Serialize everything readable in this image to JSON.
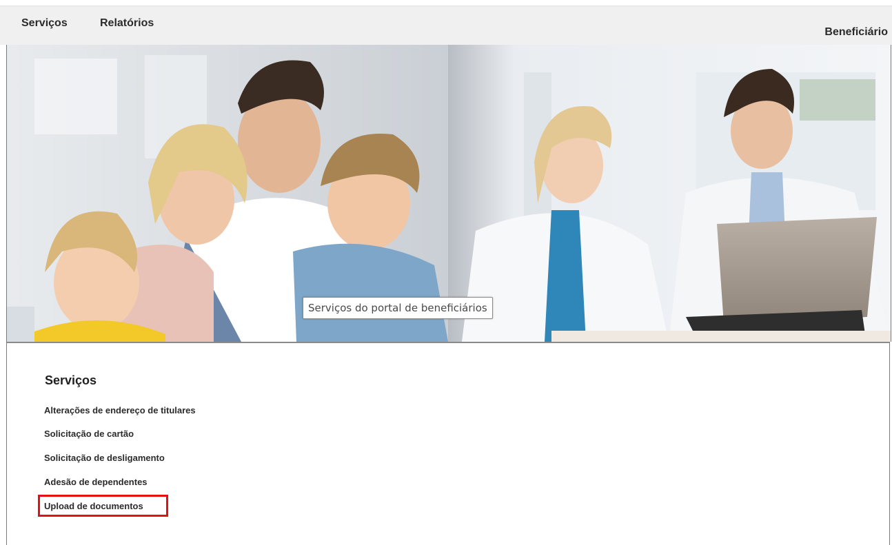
{
  "nav": {
    "items": [
      "Serviços",
      "Relatórios"
    ],
    "user_label": "Beneficiário"
  },
  "banner": {
    "caption": "Serviços do portal de beneficiários"
  },
  "services": {
    "title": "Serviços",
    "links": [
      "Alterações de endereço de titulares",
      "Solicitação de cartão",
      "Solicitação de desligamento",
      "Adesão de dependentes",
      "Upload de documentos"
    ],
    "highlighted_index": 4
  },
  "colors": {
    "highlight": "#e61010",
    "nav_background": "#f0f0f0"
  }
}
